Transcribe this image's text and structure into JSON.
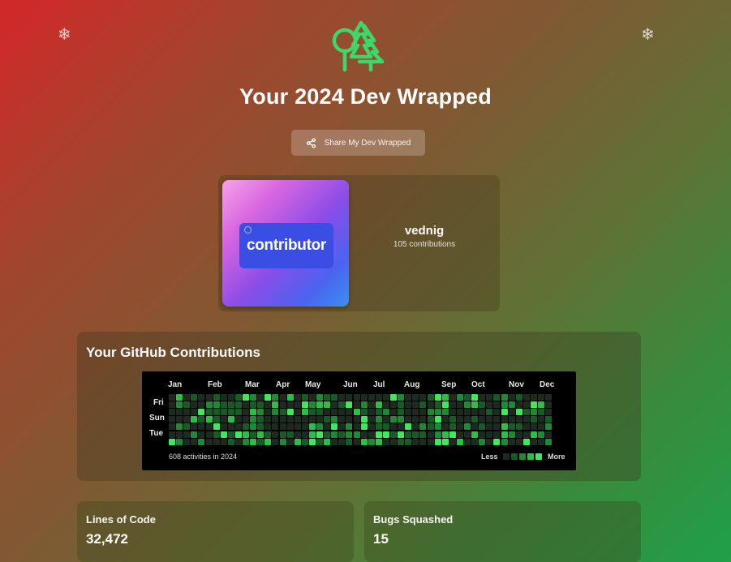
{
  "header": {
    "title": "Your 2024 Dev Wrapped",
    "share_label": "Share My Dev Wrapped",
    "icons": {
      "decoration_left": "snowflake-icon",
      "decoration_right": "snowflake-icon",
      "logo": "trees-icon",
      "share": "share-icon"
    }
  },
  "profile": {
    "badge_label": "contributor",
    "username": "vednig",
    "contributions": "105 contributions"
  },
  "github": {
    "section_title": "Your GitHub Contributions",
    "months": [
      "Jan",
      "Feb",
      "Mar",
      "Apr",
      "May",
      "Jun",
      "Jul",
      "Aug",
      "Sep",
      "Oct",
      "Nov",
      "Dec"
    ],
    "day_labels": [
      "Fri",
      "Sun",
      "Tue"
    ],
    "activities_text": "608 activities in 2024",
    "legend_less": "Less",
    "legend_more": "More",
    "colors": [
      "#1c2a1f",
      "#155c27",
      "#1f8a36",
      "#2bbf46",
      "#3ee95c"
    ]
  },
  "stats": [
    {
      "label": "Lines of Code",
      "value": "32,472"
    },
    {
      "label": "Bugs Squashed",
      "value": "15"
    }
  ]
}
